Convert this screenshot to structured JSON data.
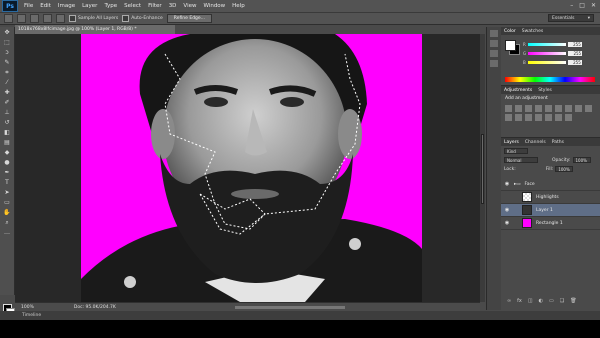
{
  "app": {
    "logo": "Ps"
  },
  "menu": [
    "File",
    "Edit",
    "Image",
    "Layer",
    "Type",
    "Select",
    "Filter",
    "3D",
    "View",
    "Window",
    "Help"
  ],
  "window_controls": [
    "–",
    "□",
    "✕"
  ],
  "options": {
    "sample_all_layers": "Sample All Layers",
    "auto_enhance": "Auto-Enhance",
    "refine_edge": "Refine Edge...",
    "workspace": "Essentials"
  },
  "document": {
    "tab_title": "1018x768x8lfcimage.jpg @ 100% (Layer 1, RGB/8) *",
    "zoom": "100%",
    "doc_info": "Doc: 95.0K/204.7K"
  },
  "timeline_label": "Timeline",
  "colors": {
    "selection": "#ff00ff",
    "layer_selected": "#5f6e87"
  },
  "color_panel": {
    "tabs": [
      "Color",
      "Swatches"
    ],
    "values": [
      "255",
      "255",
      "255"
    ]
  },
  "adjustments_panel": {
    "tabs": [
      "Adjustments",
      "Styles"
    ],
    "title": "Add an adjustment"
  },
  "layers_panel": {
    "tabs": [
      "Layers",
      "Channels",
      "Paths"
    ],
    "kind": "Kind",
    "mode": "Normal",
    "opacity_label": "Opacity:",
    "opacity": "100%",
    "lock_label": "Lock:",
    "fill_label": "Fill:",
    "fill": "100%",
    "layers": [
      {
        "name": "Face",
        "type": "group"
      },
      {
        "name": "Highlights",
        "type": "checker"
      },
      {
        "name": "Layer 1",
        "type": "person",
        "selected": true
      },
      {
        "name": "Rectangle 1",
        "type": "pink"
      }
    ]
  }
}
